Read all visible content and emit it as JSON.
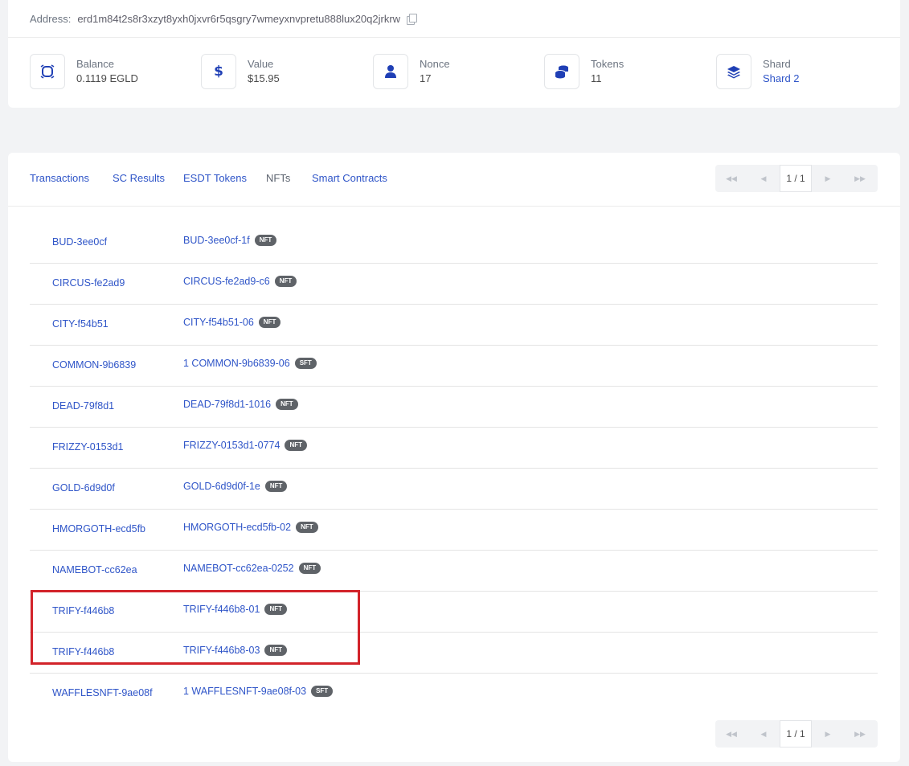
{
  "address": {
    "label": "Address:",
    "value": "erd1m84t2s8r3xzyt8yxh0jxvr6r5qsgry7wmeyxnvpretu888lux20q2jrkrw",
    "copy_icon": "copy-icon"
  },
  "stats": [
    {
      "icon": "balance-icon",
      "label": "Balance",
      "value": "0.1119 EGLD"
    },
    {
      "icon": "dollar-icon",
      "label": "Value",
      "value": "$15.95"
    },
    {
      "icon": "user-icon",
      "label": "Nonce",
      "value": "17"
    },
    {
      "icon": "coins-icon",
      "label": "Tokens",
      "value": "11"
    },
    {
      "icon": "layers-icon",
      "label": "Shard",
      "value": "Shard 2"
    }
  ],
  "tabs": [
    {
      "label": "Transactions",
      "active": false
    },
    {
      "label": "SC Results",
      "active": false
    },
    {
      "label": "ESDT Tokens",
      "active": false
    },
    {
      "label": "NFTs",
      "active": true
    },
    {
      "label": "Smart Contracts",
      "active": false
    }
  ],
  "pagination": {
    "current": "1 / 1"
  },
  "nfts": [
    {
      "collection": "BUD-3ee0cf",
      "identifier": "BUD-3ee0cf-1f",
      "type": "NFT"
    },
    {
      "collection": "CIRCUS-fe2ad9",
      "identifier": "CIRCUS-fe2ad9-c6",
      "type": "NFT"
    },
    {
      "collection": "CITY-f54b51",
      "identifier": "CITY-f54b51-06",
      "type": "NFT"
    },
    {
      "collection": "COMMON-9b6839",
      "identifier": "1 COMMON-9b6839-06",
      "type": "SFT"
    },
    {
      "collection": "DEAD-79f8d1",
      "identifier": "DEAD-79f8d1-1016",
      "type": "NFT"
    },
    {
      "collection": "FRIZZY-0153d1",
      "identifier": "FRIZZY-0153d1-0774",
      "type": "NFT"
    },
    {
      "collection": "GOLD-6d9d0f",
      "identifier": "GOLD-6d9d0f-1e",
      "type": "NFT"
    },
    {
      "collection": "HMORGOTH-ecd5fb",
      "identifier": "HMORGOTH-ecd5fb-02",
      "type": "NFT"
    },
    {
      "collection": "NAMEBOT-cc62ea",
      "identifier": "NAMEBOT-cc62ea-0252",
      "type": "NFT"
    },
    {
      "collection": "TRIFY-f446b8",
      "identifier": "TRIFY-f446b8-01",
      "type": "NFT"
    },
    {
      "collection": "TRIFY-f446b8",
      "identifier": "TRIFY-f446b8-03",
      "type": "NFT"
    },
    {
      "collection": "WAFFLESNFT-9ae08f",
      "identifier": "1 WAFFLESNFT-9ae08f-03",
      "type": "SFT"
    }
  ],
  "colors": {
    "link": "#2f55c8",
    "badge": "#5f6368",
    "highlight": "#d2232a"
  }
}
